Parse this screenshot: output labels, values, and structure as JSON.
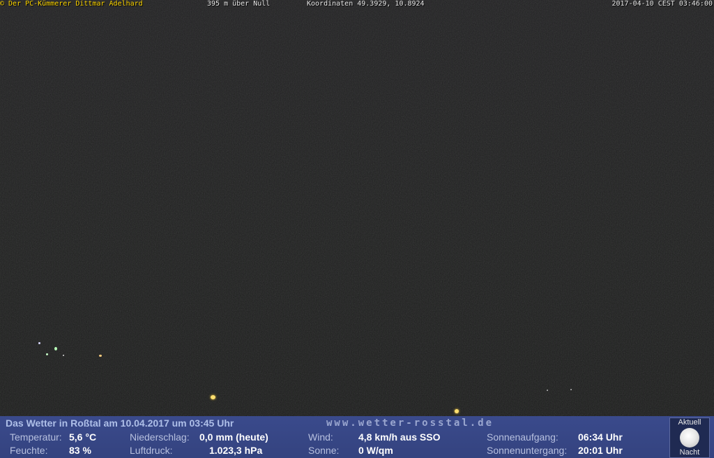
{
  "overlay": {
    "owner": "© Der PC-Kümmerer Dittmar Adelhard",
    "altitude": "395 m über Null",
    "coordinates": "Koordinaten 49.3929, 10.8924",
    "timestamp": "2017-04-10 CEST 03:46:00"
  },
  "weather": {
    "headline": "Das Wetter in Roßtal am 10.04.2017 um 03:45 Uhr",
    "site": "www.wetter-rosstal.de",
    "temperature": {
      "label": "Temperatur:",
      "value": "5,6 °C"
    },
    "humidity": {
      "label": "Feuchte:",
      "value": "83 %"
    },
    "precipitation": {
      "label": "Niederschlag:",
      "value": "0,0 mm (heute)"
    },
    "pressure": {
      "label": "Luftdruck:",
      "value": "1.023,3 hPa"
    },
    "wind": {
      "label": "Wind:",
      "value": "4,8 km/h aus SSO"
    },
    "sun": {
      "label": "Sonne:",
      "value": "0 W/qm"
    },
    "sunrise": {
      "label": "Sonnenaufgang:",
      "value": "06:34 Uhr"
    },
    "sunset": {
      "label": "Sonnenuntergang:",
      "value": "20:01 Uhr"
    }
  },
  "moon_box": {
    "top_label": "Aktuell",
    "bottom_label": "Nacht",
    "icon": "moon-icon"
  },
  "colors": {
    "overlay_owner": "#ffd700",
    "panel_bg": "#3a4a8c",
    "value_text": "#ffffff"
  }
}
